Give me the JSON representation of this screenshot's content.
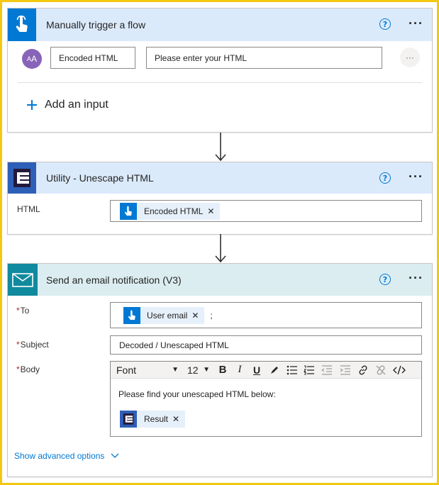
{
  "trigger": {
    "title": "Manually trigger a flow",
    "help_icon": "help-circle-icon",
    "more_icon": "more-horizontal-icon",
    "input": {
      "avatar_text": "AA",
      "name_value": "Encoded HTML",
      "placeholder": "Please enter your HTML"
    },
    "add_input_label": "Add an input",
    "accent": "#0078d4"
  },
  "unescape": {
    "title": "Utility - Unescape HTML",
    "html_label": "HTML",
    "token_label": "Encoded HTML",
    "accent": "#2a1b4d"
  },
  "email": {
    "title": "Send an email notification (V3)",
    "to_label": "To",
    "to_token": "User email",
    "to_separator": ";",
    "subject_label": "Subject",
    "subject_value": "Decoded / Unescaped HTML",
    "body_label": "Body",
    "toolbar": {
      "font": "Font",
      "size": "12",
      "bold": "B",
      "italic": "I",
      "underline": "U"
    },
    "body_text": "Please find your unescaped HTML below:",
    "body_token": "Result",
    "advanced_label": "Show advanced options",
    "accent": "#108a9e"
  },
  "colors": {
    "header_blue": "#dbeafb",
    "header_teal": "#dbedf1",
    "frame": "#f2c811",
    "token_bg": "#e6f0fa",
    "link": "#0078d4",
    "required": "#a4262c"
  }
}
